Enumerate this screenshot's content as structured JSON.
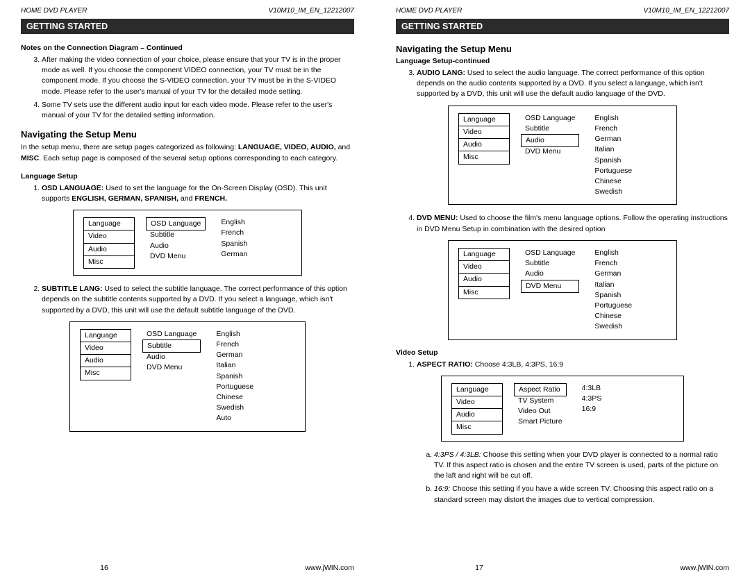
{
  "header": {
    "left": "HOME DVD PLAYER",
    "right": "V10M10_IM_EN_12212007"
  },
  "section_bar": "GETTING STARTED",
  "left_page": {
    "notes_heading": "Notes on the Connection Diagram – Continued",
    "note3": "After making the video connection of your choice, please ensure that your TV is in the proper mode as well. If you choose the component VIDEO connection, your TV must be in the component mode. If you choose the S-VIDEO connection, your TV must be in the S-VIDEO mode. Please refer to the user's manual of your TV for the detailed mode setting.",
    "note4": "Some TV sets use the different audio input for each video mode. Please refer to the user's manual of your TV for the detailed setting information.",
    "nav_heading": "Navigating the Setup Menu",
    "nav_intro_1": "In the setup menu, there are setup pages categorized as following: ",
    "nav_intro_strong": "LANGUAGE, VIDEO, AUDIO,",
    "nav_intro_2": " and ",
    "nav_intro_strong2": "MISC",
    "nav_intro_3": ". Each setup page is composed of the several setup options corresponding to each category.",
    "lang_setup_heading": "Language Setup",
    "item1_strong": "OSD LANGUAGE:",
    "item1_text": " Used to set the language for the On-Screen Display (OSD). This unit supports ",
    "item1_strong2": "ENGLISH, GERMAN, SPANISH,",
    "item1_and": " and ",
    "item1_strong3": "FRENCH.",
    "item2_strong": "SUBTITLE LANG:",
    "item2_text": " Used to select the subtitle language. The correct performance of this option depends on the subtitle contents supported by a DVD. If you select a language, which isn't supported by a DVD, this unit will use the default subtitle language of the DVD.",
    "menu_col1": [
      "Language",
      "Video",
      "Audio",
      "Misc"
    ],
    "menu_col2": [
      "OSD Language",
      "Subtitle",
      "Audio",
      "DVD Menu"
    ],
    "d1_col3": [
      "English",
      "French",
      "Spanish",
      "German"
    ],
    "d2_col3": [
      "English",
      "French",
      "German",
      "Italian",
      "Spanish",
      "Portuguese",
      "Chinese",
      "Swedish",
      "Auto"
    ],
    "page_num": "16"
  },
  "right_page": {
    "nav_heading": "Navigating the Setup Menu",
    "lang_cont_heading": "Language Setup-continued",
    "item3_strong": "AUDIO LANG:",
    "item3_text": " Used to select the audio language. The correct performance of this option depends on the audio contents supported by a DVD. If you select a language, which isn't supported by a DVD, this unit will use the default audio language of the DVD.",
    "d3_col3": [
      "English",
      "French",
      "German",
      "Italian",
      "Spanish",
      "Portuguese",
      "Chinese",
      "Swedish"
    ],
    "item4_strong": "DVD MENU:",
    "item4_text": "  Used to choose the film's menu language options. Follow the operating instructions in DVD Menu Setup in combination with the desired option",
    "video_setup_heading": "Video Setup",
    "aspect_strong": "ASPECT RATIO:",
    "aspect_text": " Choose 4:3LB, 4:3PS, 16:9",
    "menu_col2_v": [
      "Aspect Ratio",
      "TV System",
      "Video Out",
      "Smart Picture"
    ],
    "d5_col3": [
      "4:3LB",
      "4:3PS",
      "16:9"
    ],
    "sub_a_em": "4:3PS / 4:3LB:",
    "sub_a": " Choose this setting when your DVD player is connected to a normal ratio TV. If this aspect ratio is chosen and the entire TV screen is used, parts of the picture on the laft and right will be cut off.",
    "sub_b_em": "16:9:",
    "sub_b": " Choose this setting if you have a wide screen TV. Choosing this aspect ratio on a standard screen may distort the images due to vertical compression.",
    "page_num": "17"
  },
  "footer_site": "www.jWIN.com"
}
